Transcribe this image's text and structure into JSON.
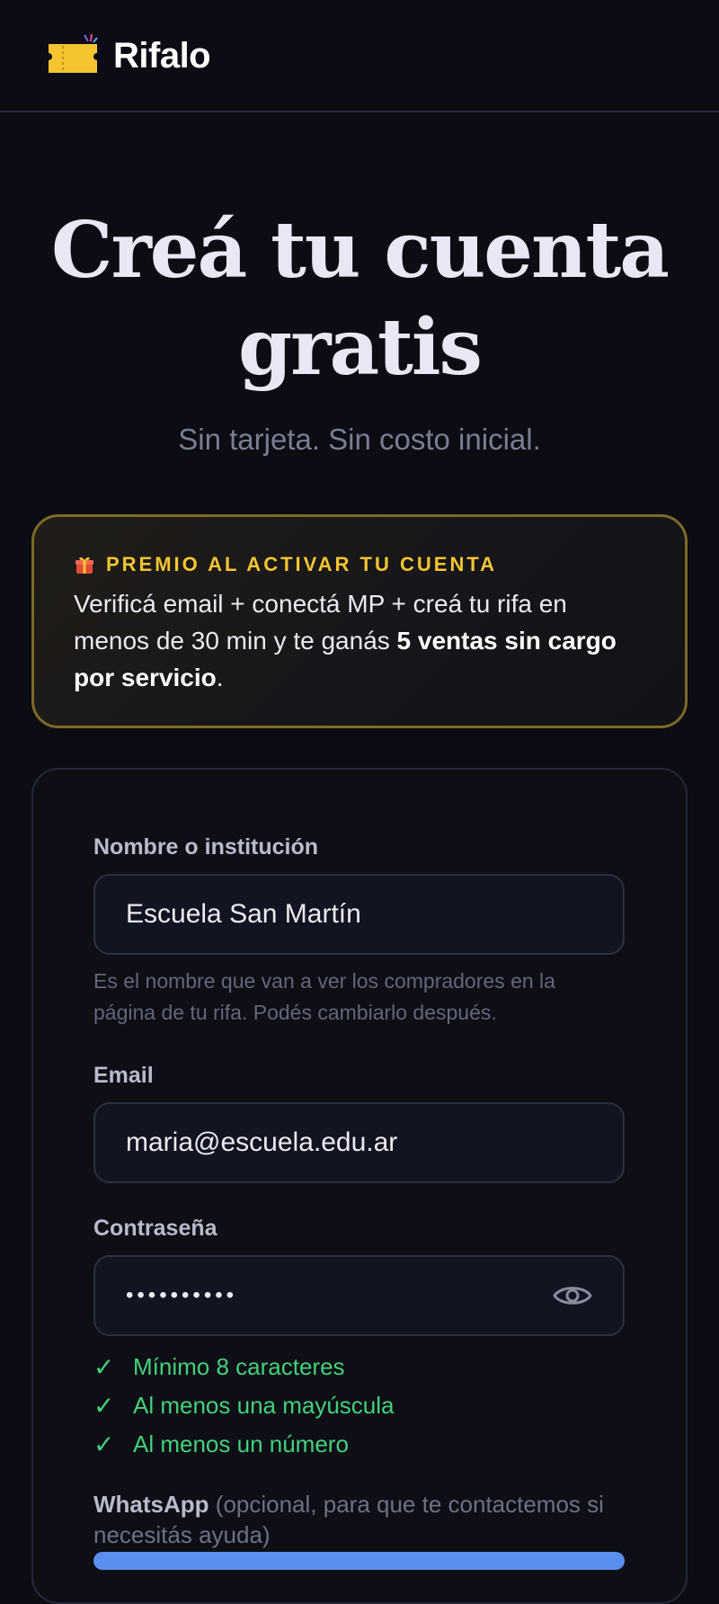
{
  "brand": {
    "name": "Rifalo",
    "logo_icon": "ticket-icon",
    "logo_color": "#f5c531"
  },
  "hero": {
    "title": "Creá tu cuenta gratis",
    "subtitle": "Sin tarjeta. Sin costo inicial."
  },
  "promo": {
    "icon": "gift-icon",
    "label": "PREMIO AL ACTIVAR TU CUENTA",
    "body_prefix": "Verificá email + conectá MP + creá tu rifa en menos de 30 min y te ganás ",
    "body_bold": "5 ventas sin cargo por servicio",
    "body_suffix": "."
  },
  "form": {
    "name": {
      "label": "Nombre o institución",
      "value": "Escuela San Martín",
      "help": "Es el nombre que van a ver los compradores en la página de tu rifa. Podés cambiarlo después."
    },
    "email": {
      "label": "Email",
      "value": "maria@escuela.edu.ar"
    },
    "password": {
      "label": "Contraseña",
      "value": "••••••••••",
      "toggle_icon": "eye-icon",
      "requirements": [
        "Mínimo 8 caracteres",
        "Al menos una mayúscula",
        "Al menos un número"
      ]
    },
    "whatsapp": {
      "label": "WhatsApp",
      "hint": "(opcional, para que te contactemos si necesitás ayuda)"
    }
  },
  "colors": {
    "background": "#0b0c14",
    "accent_gold": "#f5c531",
    "success_green": "#43d17a",
    "primary_blue": "#5b8ef0"
  }
}
